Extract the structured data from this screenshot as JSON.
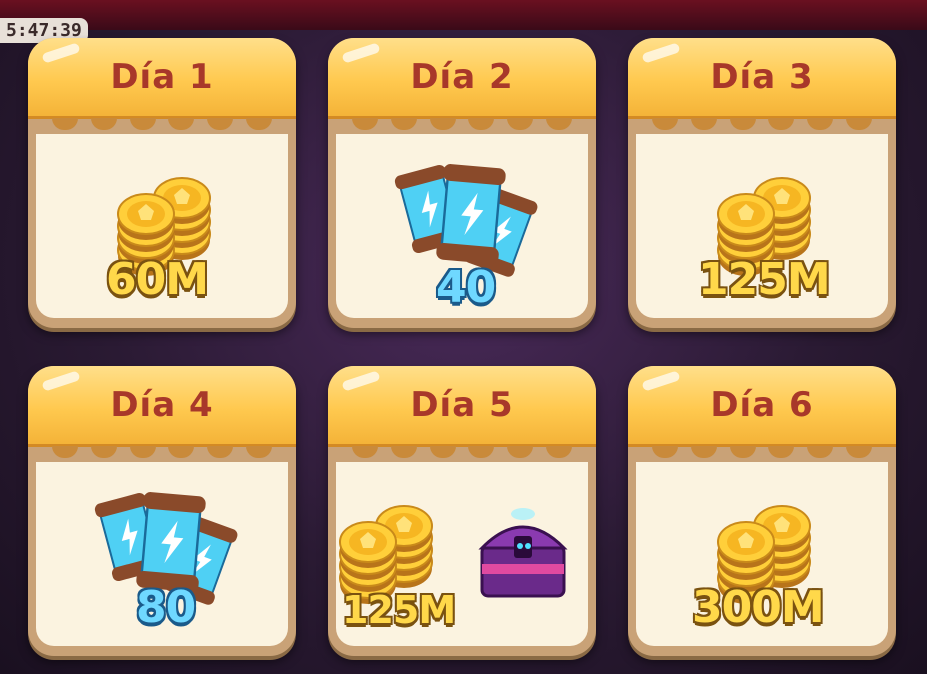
{
  "hud": {
    "timer": "5:47:39"
  },
  "rewards": [
    {
      "day_label": "Día 1",
      "reward_text": "60M",
      "kind": "coins"
    },
    {
      "day_label": "Día 2",
      "reward_text": "40",
      "kind": "spins"
    },
    {
      "day_label": "Día 3",
      "reward_text": "125M",
      "kind": "coins"
    },
    {
      "day_label": "Día 4",
      "reward_text": "80",
      "kind": "spins"
    },
    {
      "day_label": "Día 5",
      "reward_text": "125M",
      "kind": "coins-and-chest"
    },
    {
      "day_label": "Día 6",
      "reward_text": "300M",
      "kind": "coins"
    }
  ],
  "icons": {
    "coins": "coin-stack-icon",
    "spins": "energy-capsule-icon",
    "chest": "treasure-chest-icon"
  },
  "colors": {
    "header_gold": "#ffc94f",
    "title_red": "#a8382a",
    "card_body": "#fbf3e0",
    "coin_text": "#ffd84a",
    "spin_text": "#6fd8ff"
  }
}
